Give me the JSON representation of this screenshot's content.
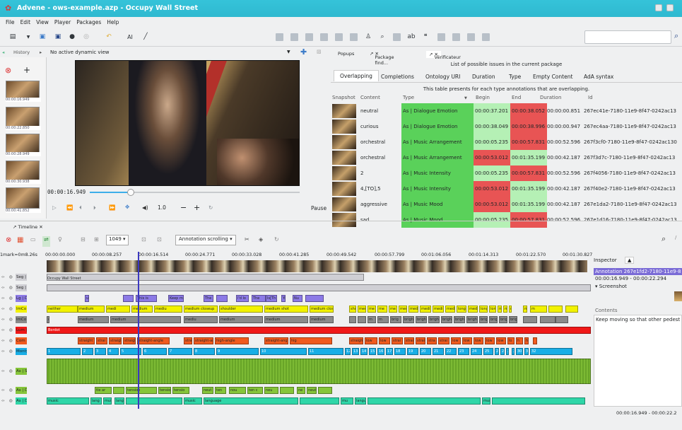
{
  "window": {
    "title": "Advene - ows-example.azp - Occupy Wall Street"
  },
  "menu": [
    "File",
    "Edit",
    "View",
    "Player",
    "Packages",
    "Help"
  ],
  "history": {
    "tab": "History",
    "thumbs": [
      "00:00:16.949",
      "00:00:22.850",
      "00:00:28.949",
      "00:00:30.938",
      "00:00:41.852"
    ]
  },
  "dynview": {
    "label": "No active dynamic view"
  },
  "player": {
    "time": "00:00:16.949",
    "rate": "1.0",
    "pause": "Pause"
  },
  "right_tabs": [
    "Popups",
    "Package find...",
    "Vérificateur"
  ],
  "issues": {
    "title": "List of possible issues in the current package",
    "tabs": [
      "Overlapping",
      "Completions",
      "Ontology URI",
      "Duration",
      "Type",
      "Empty Content",
      "AdA syntax"
    ],
    "note": "This table presents for each type annotations that are overlapping.",
    "columns": [
      "Snapshot",
      "Content",
      "Type",
      "Begin",
      "End",
      "Duration",
      "Id"
    ],
    "rows": [
      {
        "content": "neutral",
        "type": "As | Dialogue Emotion",
        "begin": "00:00:37.201",
        "end": "00:00:38.052",
        "duration": "00:00:00.851",
        "id": "267ec41e-7180-11e9-8f47-0242ac13"
      },
      {
        "content": "curious",
        "type": "As | Dialogue Emotion",
        "begin": "00:00:38.049",
        "end": "00:00:38.996",
        "duration": "00:00:00.947",
        "id": "267ec4aa-7180-11e9-8f47-0242ac13"
      },
      {
        "content": "orchestral",
        "type": "As | Music Arrangement",
        "begin": "00:00:05.235",
        "end": "00:00:57.831",
        "duration": "00:00:52.596",
        "id": "267f3cf0-7180-11e9-8f47-0242ac130"
      },
      {
        "content": "orchestral",
        "type": "As | Music Arrangement",
        "begin": "00:00:53.012",
        "end": "00:01:35.199",
        "duration": "00:00:42.187",
        "id": "267f3d7c-7180-11e9-8f47-0242ac13"
      },
      {
        "content": "2",
        "type": "As | Music Intensity",
        "begin": "00:00:05.235",
        "end": "00:00:57.831",
        "duration": "00:00:52.596",
        "id": "267f4056-7180-11e9-8f47-0242ac13"
      },
      {
        "content": "4,[TO],5",
        "type": "As | Music Intensity",
        "begin": "00:00:53.012",
        "end": "00:01:35.199",
        "duration": "00:00:42.187",
        "id": "267f40e2-7180-11e9-8f47-0242ac13"
      },
      {
        "content": "aggressive",
        "type": "As | Music Mood",
        "begin": "00:00:53.012",
        "end": "00:01:35.199",
        "duration": "00:00:42.187",
        "id": "267e1da2-7180-11e9-8f47-0242ac13"
      },
      {
        "content": "sad",
        "type": "As | Music Mood",
        "begin": "00:00:05.235",
        "end": "00:00:57.831",
        "duration": "00:00:52.596",
        "id": "267e1d16-7180-11e9-8f47-0242ac13"
      }
    ]
  },
  "timeline": {
    "tab": "Timeline",
    "zoom": "1049",
    "scroll_mode": "Annotation scrolling",
    "ruler": [
      "1mark=0m8.26s",
      "00:00:00.000",
      "00:00:08.257",
      "00:00:16.514",
      "00:00:24.771",
      "00:00:33.028",
      "00:00:41.285",
      "00:00:49.542",
      "00:00:57.799",
      "00:01:06.056",
      "00:01:14.313",
      "00:01:22.570",
      "00:01:30.827"
    ],
    "tracks": [
      "Seg | Expo",
      "Seg | Scen",
      "Lg | Dom",
      "ImCo | Fie",
      "ImCo | Im",
      "Lum | Co",
      "Com | Co",
      "Monty | S",
      "As | Soun",
      "As | Dom",
      "As | Dom"
    ]
  },
  "inspector": {
    "title": "Inspector",
    "annotation": "Annotation 267e1fd2-7180-11e9-8",
    "range": "00:00:16.949 - 00:00:22.294",
    "screenshot": "Screenshot",
    "contents_label": "Contents",
    "contents": "Keep moving so that other pedest"
  },
  "status": {
    "range": "00:00:16.949 - 00:00:22.2"
  }
}
